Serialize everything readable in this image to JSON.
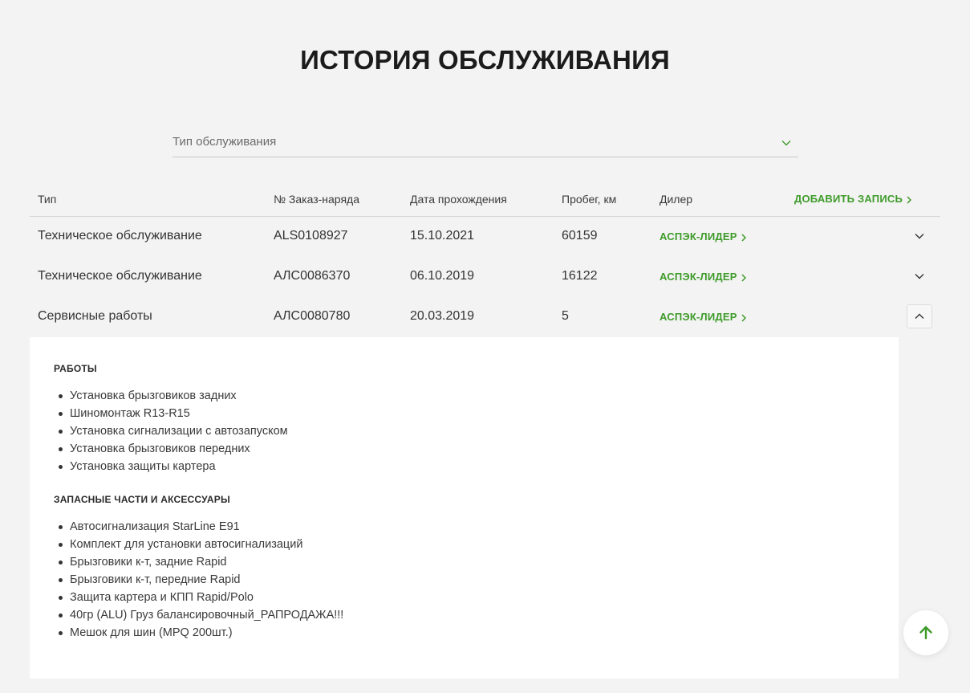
{
  "page_title": "ИСТОРИЯ ОБСЛУЖИВАНИЯ",
  "filter": {
    "placeholder": "Тип обслуживания"
  },
  "table": {
    "headers": {
      "type": "Тип",
      "order": "№ Заказ-наряда",
      "date": "Дата прохождения",
      "mileage": "Пробег, км",
      "dealer": "Дилер"
    },
    "add_label": "ДОБАВИТЬ ЗАПИСЬ",
    "rows": [
      {
        "type": "Техническое обслуживание",
        "order": "ALS0108927",
        "date": "15.10.2021",
        "mileage": "60159",
        "dealer": "АСПЭК-ЛИДЕР"
      },
      {
        "type": "Техническое обслуживание",
        "order": "АЛС0086370",
        "date": "06.10.2019",
        "mileage": "16122",
        "dealer": "АСПЭК-ЛИДЕР"
      },
      {
        "type": "Сервисные работы",
        "order": "АЛС0080780",
        "date": "20.03.2019",
        "mileage": "5",
        "dealer": "АСПЭК-ЛИДЕР"
      }
    ]
  },
  "details": {
    "works_title": "РАБОТЫ",
    "works": [
      "Установка брызговиков задних",
      "Шиномонтаж R13-R15",
      "Установка сигнализации с автозапуском",
      "Установка брызговиков передних",
      "Установка защиты картера"
    ],
    "parts_title": "ЗАПАСНЫЕ ЧАСТИ И АКСЕССУАРЫ",
    "parts": [
      "Автосигнализация StarLine E91",
      "Комплект для установки автосигнализаций",
      "Брызговики к-т, задние Rapid",
      "Брызговики к-т, передние Rapid",
      "Защита картера и КПП Rapid/Polo",
      "40гр (ALU) Груз балансировочный_РАПРОДАЖА!!!",
      "Мешок для шин (MPQ 200шт.)"
    ]
  },
  "colors": {
    "accent": "#3e9b2a",
    "background": "#f3f3f3"
  },
  "icons": {
    "dropdown": "chevron-down-icon",
    "link": "chevron-right-icon",
    "scroll_top": "arrow-up-icon"
  }
}
